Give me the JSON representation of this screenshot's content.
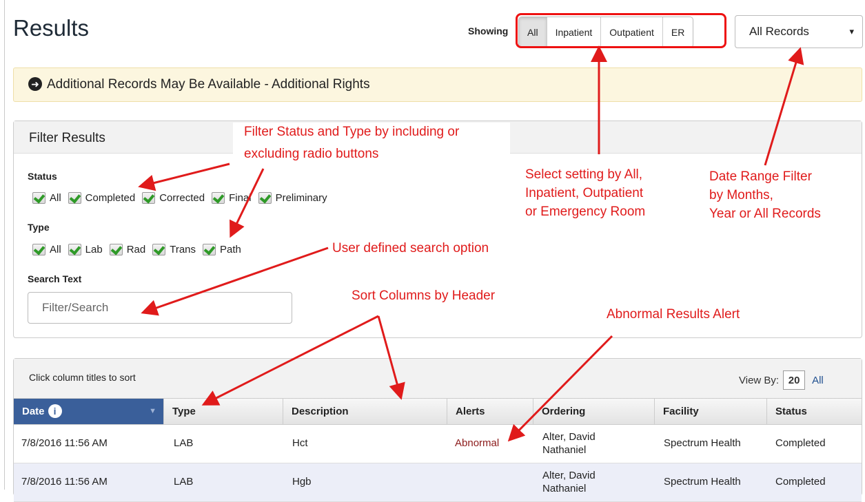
{
  "page": {
    "title": "Results"
  },
  "showing": {
    "label": "Showing",
    "options": [
      "All",
      "Inpatient",
      "Outpatient",
      "ER"
    ],
    "active": "All"
  },
  "date_range": {
    "selected": "All Records",
    "caret": "▾"
  },
  "banner": {
    "icon": "arrow-circle-right-icon",
    "text": "Additional Records May Be Available - Additional Rights"
  },
  "filter": {
    "title": "Filter Results",
    "status_label": "Status",
    "status": [
      "All",
      "Completed",
      "Corrected",
      "Final",
      "Preliminary"
    ],
    "type_label": "Type",
    "types": [
      "All",
      "Lab",
      "Rad",
      "Trans",
      "Path"
    ],
    "search_label": "Search Text",
    "search_placeholder": "Filter/Search"
  },
  "table": {
    "sort_hint": "Click column titles to sort",
    "view_by_label": "View By:",
    "view_by_value": "20",
    "view_by_all": "All",
    "headers": [
      "Date",
      "Type",
      "Description",
      "Alerts",
      "Ordering",
      "Facility",
      "Status"
    ],
    "rows": [
      {
        "date": "7/8/2016 11:56 AM",
        "type": "LAB",
        "description": "Hct",
        "alert": "Abnormal",
        "ordering_1": "Alter, David",
        "ordering_2": "Nathaniel",
        "facility": "Spectrum Health",
        "status": "Completed"
      },
      {
        "date": "7/8/2016 11:56 AM",
        "type": "LAB",
        "description": "Hgb",
        "alert": "",
        "ordering_1": "Alter, David",
        "ordering_2": "Nathaniel",
        "facility": "Spectrum Health",
        "status": "Completed"
      }
    ]
  },
  "annotations": {
    "filter_note_1": "Filter Status and Type by including or",
    "filter_note_2": "excluding radio buttons",
    "setting_note_1": "Select setting by All,",
    "setting_note_2": "Inpatient, Outpatient",
    "setting_note_3": "or Emergency Room",
    "date_note_1": "Date Range Filter",
    "date_note_2": "by Months,",
    "date_note_3": "Year or All Records",
    "search_note": "User defined search option",
    "sort_note": "Sort Columns by Header",
    "abnormal_note": "Abnormal Results Alert"
  },
  "colors": {
    "annotation": "#e01b1b",
    "date_header": "#3a5f9a",
    "abnormal": "#8b1a1a",
    "banner": "#fcf6df"
  }
}
